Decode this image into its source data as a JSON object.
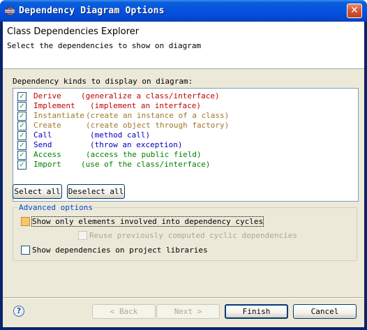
{
  "window": {
    "title": "Dependency Diagram Options",
    "close_glyph": "✕"
  },
  "banner": {
    "title": "Class Dependencies Explorer",
    "description": "Select the dependencies to show on diagram"
  },
  "kinds": {
    "label": "Dependency kinds to display on diagram:",
    "items": [
      {
        "name": "Derive",
        "description": "(generalize a class/interface)",
        "checked": true,
        "color": "#c00000"
      },
      {
        "name": "Implement",
        "description": "(implement an interface)",
        "checked": true,
        "color": "#c00000"
      },
      {
        "name": "Instantiate",
        "description": "(create an instance of a class)",
        "checked": true,
        "color": "#a07828"
      },
      {
        "name": "Create",
        "description": "(create object through factory)",
        "checked": true,
        "color": "#a07828"
      },
      {
        "name": "Call",
        "description": "(method call)",
        "checked": true,
        "color": "#0000c0"
      },
      {
        "name": "Send",
        "description": "(throw an exception)",
        "checked": true,
        "color": "#0000c0"
      },
      {
        "name": "Access",
        "description": "(access the public field)",
        "checked": true,
        "color": "#008000"
      },
      {
        "name": "Import",
        "description": "(use of the class/interface)",
        "checked": true,
        "color": "#008000"
      }
    ]
  },
  "buttons": {
    "select_all": "Select all",
    "deselect_all": "Deselect all"
  },
  "advanced": {
    "title": "Advanced options",
    "show_cycles": {
      "label": "Show only elements involved into dependency cycles",
      "checked": false
    },
    "reuse_cycles": {
      "label": "Reuse previously computed cyclic dependencies",
      "checked": false,
      "enabled": false
    },
    "show_libraries": {
      "label": "Show dependencies on project libraries",
      "checked": false
    }
  },
  "footer": {
    "back": "< Back",
    "next": "Next >",
    "finish": "Finish",
    "cancel": "Cancel"
  },
  "icons": {
    "help": "?",
    "check": "✓"
  }
}
